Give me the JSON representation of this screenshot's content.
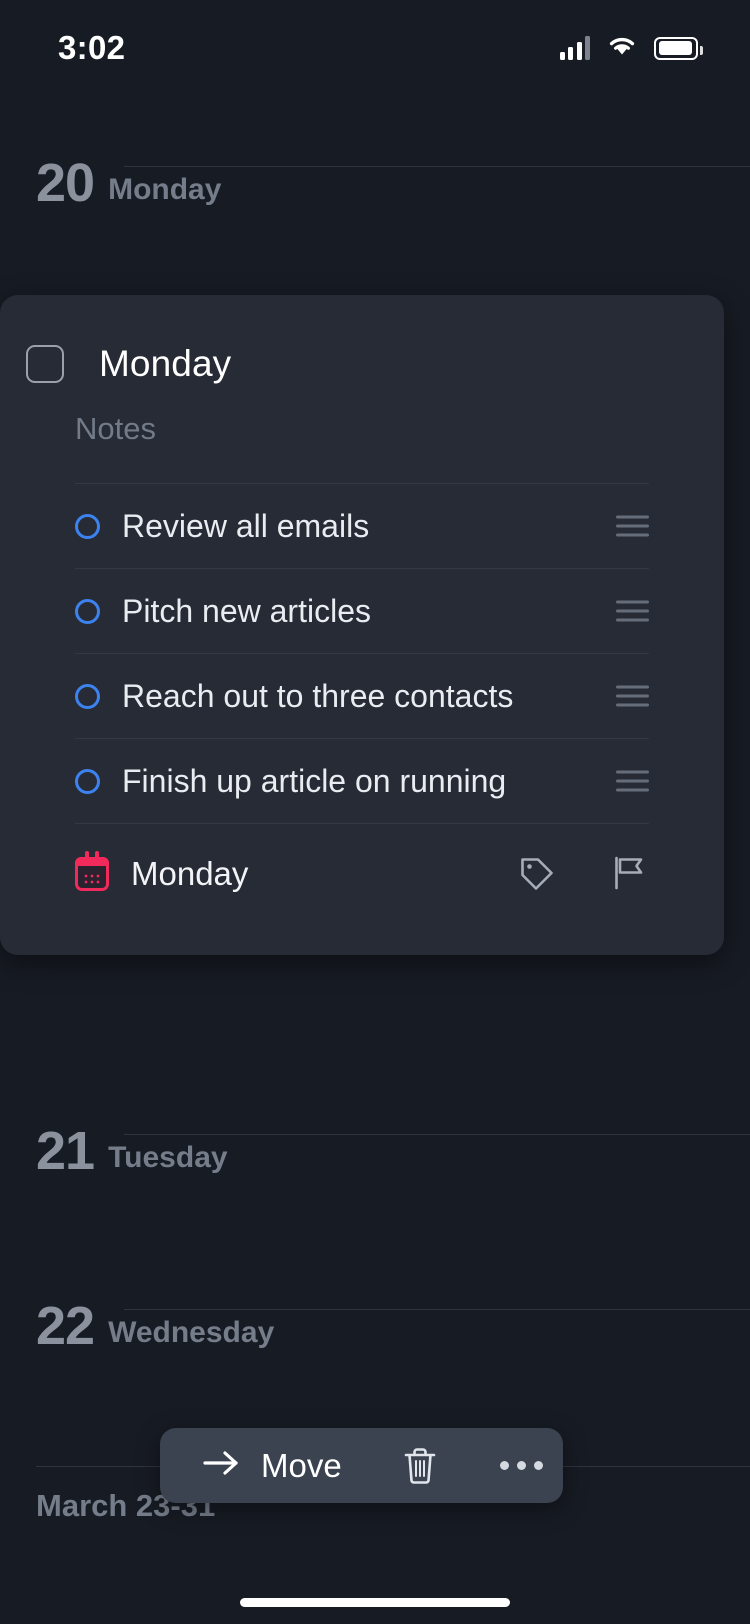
{
  "status_bar": {
    "time": "3:02",
    "cellular_icon": "cellular-signal-icon",
    "wifi_icon": "wifi-icon",
    "battery_icon": "battery-icon"
  },
  "days": [
    {
      "number": "20",
      "name": "Monday"
    },
    {
      "number": "21",
      "name": "Tuesday"
    },
    {
      "number": "22",
      "name": "Wednesday"
    }
  ],
  "month_divider": {
    "label": "March 23-31"
  },
  "task_card": {
    "checkbox_state": "unchecked",
    "title": "Monday",
    "notes_placeholder": "Notes",
    "subtasks": [
      {
        "label": "Review all emails",
        "state": "unchecked",
        "handle": "drag-handle-icon"
      },
      {
        "label": "Pitch new articles",
        "state": "unchecked",
        "handle": "drag-handle-icon"
      },
      {
        "label": "Reach out to three contacts",
        "state": "unchecked",
        "handle": "drag-handle-icon"
      },
      {
        "label": "Finish up article on running",
        "state": "unchecked",
        "handle": "drag-handle-icon"
      }
    ],
    "footer": {
      "date_icon": "calendar-icon",
      "date_label": "Monday",
      "tag_icon": "tag-icon",
      "flag_icon": "flag-icon"
    }
  },
  "action_bar": {
    "move_icon": "arrow-right-icon",
    "move_label": "Move",
    "delete_icon": "trash-icon",
    "more_icon": "more-options-icon"
  },
  "colors": {
    "page_background": "#171b23",
    "card_background": "#272b35",
    "accent_blue": "#3c83f0",
    "accent_pink": "#f2295b",
    "action_bar": "#3b4350",
    "muted_text": "#757d8a",
    "divider": "#343945"
  }
}
